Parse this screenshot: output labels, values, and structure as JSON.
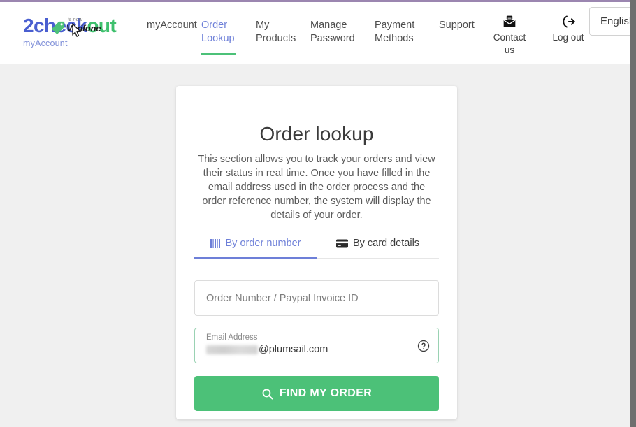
{
  "window": {
    "top_border_color": "#9b86b0",
    "right_edge_color": "#6f6f6f"
  },
  "header": {
    "logo": {
      "word_part1": "2check",
      "word_part2": "out",
      "subtitle": "myAccount",
      "tag_icon": "price-tag-icon",
      "is_now": "is now",
      "brand": "Verifone",
      "color_blue": "#4a5fd0",
      "color_green": "#3ec06d"
    },
    "nav": [
      {
        "label": "myAccount",
        "active": false
      },
      {
        "label": "Order Lookup",
        "active": true
      },
      {
        "label": "My Products",
        "active": false
      },
      {
        "label": "Manage Password",
        "active": false
      },
      {
        "label": "Payment Methods",
        "active": false
      },
      {
        "label": "Support",
        "active": false
      }
    ],
    "active_nav_underline_color": "#4cc178",
    "actions": [
      {
        "label": "Contact us",
        "icon": "mail-envelope-icon"
      },
      {
        "label": "Log out",
        "icon": "logout-arrow-icon"
      }
    ],
    "language_select": {
      "value": "English",
      "icon": "chevron-down-icon"
    }
  },
  "main": {
    "title": "Order lookup",
    "description": "This section allows you to track your orders and view their status in real time. Once you have filled in the email address used in the order process and the order reference number, the system will display the details of your order.",
    "tabs": [
      {
        "label": "By order number",
        "icon": "barcode-icon",
        "active": true
      },
      {
        "label": "By card details",
        "icon": "credit-card-icon",
        "active": false
      }
    ],
    "active_tab_color": "#6d7fd8",
    "order_number_field": {
      "placeholder": "Order Number / Paypal Invoice ID",
      "value": ""
    },
    "email_field": {
      "label": "Email Address",
      "value": "@plumsail.com",
      "redacted_prefix": true,
      "help_icon": "question-mark-circle-icon",
      "border_color": "#9ad2b3"
    },
    "submit_button": {
      "label": "FIND MY ORDER",
      "icon": "search-magnifier-icon",
      "color": "#4cc178"
    }
  }
}
